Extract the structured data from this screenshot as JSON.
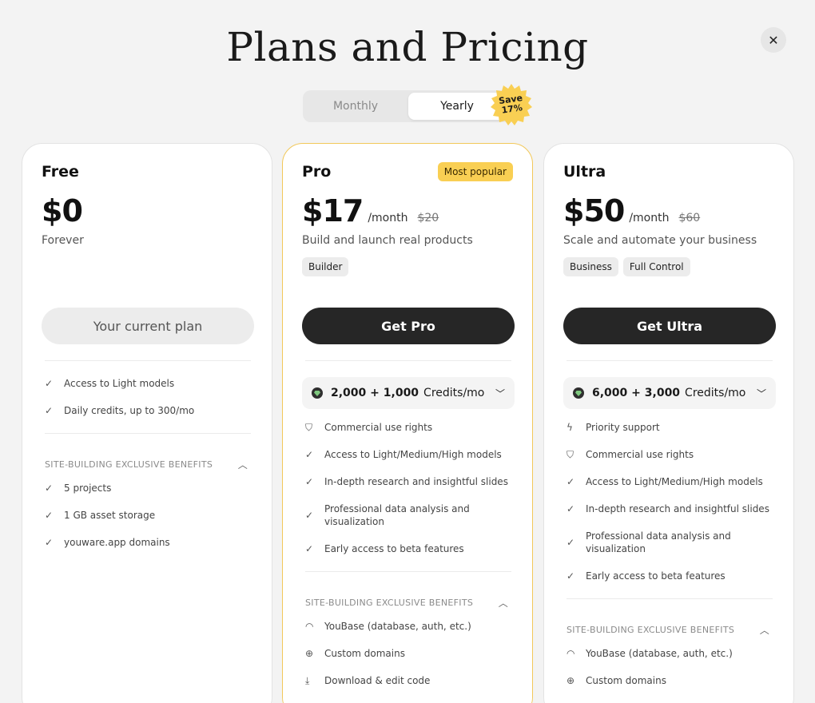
{
  "header": {
    "title": "Plans and Pricing",
    "close_icon": "close-icon"
  },
  "billing_toggle": {
    "monthly": "Monthly",
    "yearly": "Yearly",
    "selected": "Yearly",
    "save_line1": "Save",
    "save_line2": "17%"
  },
  "colors": {
    "accent": "#f9cf53",
    "dark_button": "#262626",
    "pro_border": "#f2c85a"
  },
  "plans": [
    {
      "name": "Free",
      "price": "$0",
      "subtitle": "Forever",
      "cta": "Your current plan",
      "features": [
        {
          "icon": "check-icon",
          "text": "Access to Light models"
        },
        {
          "icon": "check-icon",
          "text": "Daily credits, up to 300/mo"
        }
      ],
      "section_title": "SITE-BUILDING EXCLUSIVE BENEFITS",
      "section_features": [
        {
          "icon": "check-icon",
          "text": "5 projects"
        },
        {
          "icon": "check-icon",
          "text": "1 GB asset storage"
        },
        {
          "icon": "check-icon",
          "text": "youware.app domains"
        }
      ]
    },
    {
      "name": "Pro",
      "badge": "Most popular",
      "price": "$17",
      "per": "/month",
      "old_price": "$20",
      "subtitle": "Build and launch real products",
      "tags": [
        "Builder"
      ],
      "cta": "Get Pro",
      "credits": {
        "amount": "2,000 + 1,000",
        "unit": "Credits/mo"
      },
      "features": [
        {
          "icon": "shield-icon",
          "text": "Commercial use rights"
        },
        {
          "icon": "check-icon",
          "text": "Access to Light/Medium/High models"
        },
        {
          "icon": "check-icon",
          "text": "In-depth research and insightful slides"
        },
        {
          "icon": "check-icon",
          "text": "Professional data analysis and visualization"
        },
        {
          "icon": "check-icon",
          "text": "Early access to beta features"
        }
      ],
      "section_title": "SITE-BUILDING EXCLUSIVE BENEFITS",
      "section_features": [
        {
          "icon": "arc-icon",
          "text": "YouBase (database, auth, etc.)"
        },
        {
          "icon": "globe-icon",
          "text": "Custom domains"
        },
        {
          "icon": "download-icon",
          "text": "Download & edit code"
        }
      ]
    },
    {
      "name": "Ultra",
      "price": "$50",
      "per": "/month",
      "old_price": "$60",
      "subtitle": "Scale and automate your business",
      "tags": [
        "Business",
        "Full Control"
      ],
      "cta": "Get Ultra",
      "credits": {
        "amount": "6,000 + 3,000",
        "unit": "Credits/mo"
      },
      "features": [
        {
          "icon": "lightning-icon",
          "text": "Priority support"
        },
        {
          "icon": "shield-icon",
          "text": "Commercial use rights"
        },
        {
          "icon": "check-icon",
          "text": "Access to Light/Medium/High models"
        },
        {
          "icon": "check-icon",
          "text": "In-depth research and insightful slides"
        },
        {
          "icon": "check-icon",
          "text": "Professional data analysis and visualization"
        },
        {
          "icon": "check-icon",
          "text": "Early access to beta features"
        }
      ],
      "section_title": "SITE-BUILDING EXCLUSIVE BENEFITS",
      "section_features": [
        {
          "icon": "arc-icon",
          "text": "YouBase (database, auth, etc.)"
        },
        {
          "icon": "globe-icon",
          "text": "Custom domains"
        }
      ]
    }
  ]
}
